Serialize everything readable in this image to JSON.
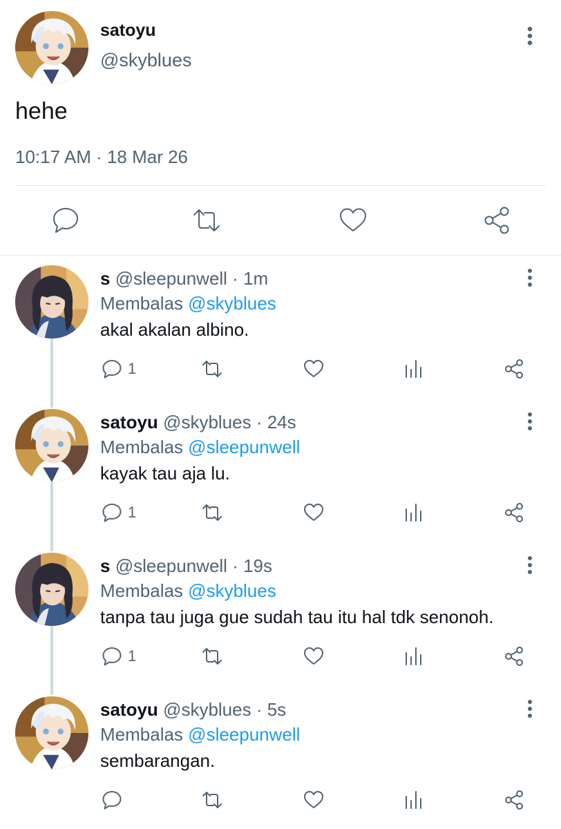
{
  "main_tweet": {
    "name": "satoyu",
    "handle": "@skyblues",
    "text": "hehe",
    "meta": "10:17 AM · 18 Mar 26",
    "avatar_icon": "avatar-white-hair-character"
  },
  "replies": [
    {
      "name": "s",
      "handle": "@sleepunwell · 1m",
      "reply_prefix": "Membalas",
      "reply_to": "@skyblues",
      "text": "akal akalan albino.",
      "reply_count": "1",
      "avatar_icon": "avatar-dark-hair-character"
    },
    {
      "name": "satoyu",
      "handle": "@skyblues · 24s",
      "reply_prefix": "Membalas",
      "reply_to": "@sleepunwell",
      "text": "kayak tau aja lu.",
      "reply_count": "1",
      "avatar_icon": "avatar-white-hair-character"
    },
    {
      "name": "s",
      "handle": "@sleepunwell · 19s",
      "reply_prefix": "Membalas",
      "reply_to": "@skyblues",
      "text": "tanpa tau juga gue sudah tau itu hal tdk senonoh.",
      "reply_count": "1",
      "avatar_icon": "avatar-dark-hair-character"
    },
    {
      "name": "satoyu",
      "handle": "@skyblues · 5s",
      "reply_prefix": "Membalas",
      "reply_to": "@sleepunwell",
      "text": "sembarangan.",
      "reply_count": "",
      "avatar_icon": "avatar-white-hair-character"
    }
  ],
  "colors": {
    "text": "#0f1419",
    "secondary": "#536471",
    "mention": "#1d9bf0",
    "divider": "#e6ecf0"
  }
}
